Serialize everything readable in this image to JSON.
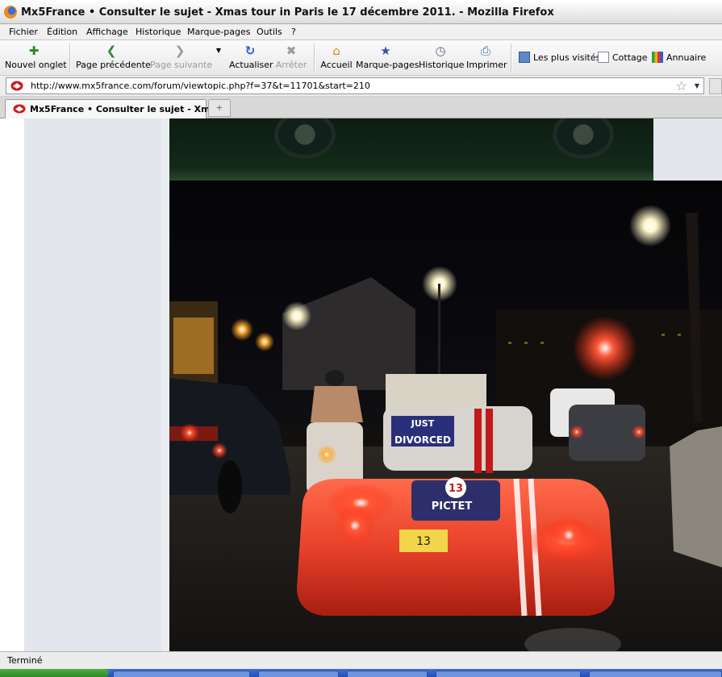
{
  "window": {
    "title": "Mx5France • Consulter le sujet - Xmas tour in Paris le 17 décembre 2011. - Mozilla Firefox"
  },
  "menu": {
    "items": [
      {
        "label": "Fichier"
      },
      {
        "label": "Édition"
      },
      {
        "label": "Affichage"
      },
      {
        "label": "Historique"
      },
      {
        "label": "Marque-pages"
      },
      {
        "label": "Outils"
      },
      {
        "label": "?"
      }
    ]
  },
  "toolbar": {
    "new_tab": "Nouvel onglet",
    "back": "Page précédente",
    "forward": "Page suivante",
    "reload": "Actualiser",
    "stop": "Arrêter",
    "home": "Accueil",
    "bookmarks": "Marque-pages",
    "history": "Historique",
    "print": "Imprimer"
  },
  "bookmarks_bar": {
    "items": [
      {
        "label": "Les plus visités",
        "icon": "most-visited-icon"
      },
      {
        "label": "Cottage",
        "icon": "page-icon"
      },
      {
        "label": "Annuaire",
        "icon": "directory-icon"
      }
    ]
  },
  "address": {
    "url": "http://www.mx5france.com/forum/viewtopic.php?f=37&t=11701&start=210"
  },
  "tabs": [
    {
      "label": "Mx5France • Consulter le sujet - Xm..."
    }
  ],
  "photo": {
    "sign_text_1": "JUST",
    "sign_text_2": "DIVORCED",
    "badge_number": "13",
    "badge_brand": "PICTET",
    "plate_text": "13"
  },
  "status": {
    "text": "Terminé"
  },
  "colors": {
    "accent": "#2a5bd7",
    "taillight": "#ff3b1a",
    "car_body": "#e8422a"
  }
}
